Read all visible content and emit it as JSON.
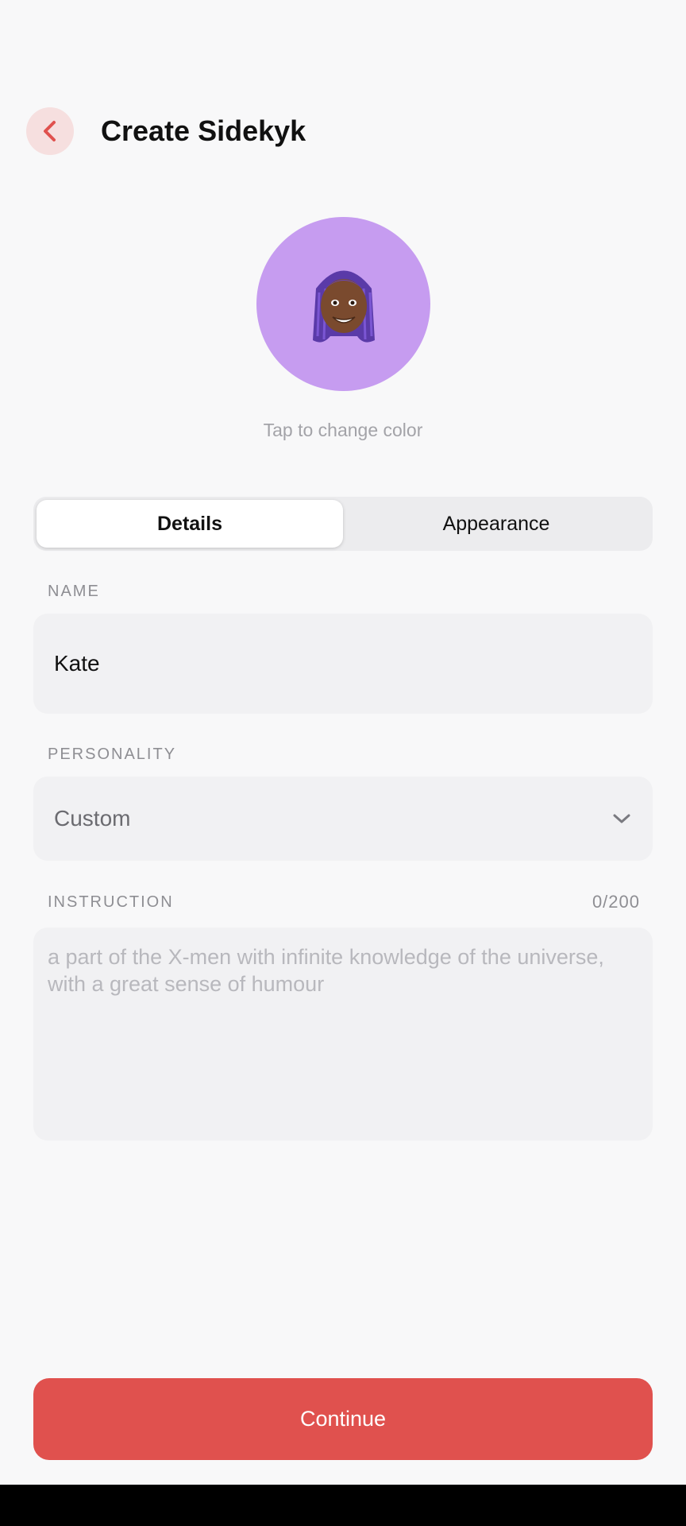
{
  "header": {
    "title": "Create Sidekyk",
    "back_icon": "chevron-left-icon",
    "back_color": "#e0514e"
  },
  "avatar": {
    "color": "#c69cf0",
    "icon": "memoji-avatar",
    "hint": "Tap to change color"
  },
  "tabs": [
    {
      "label": "Details",
      "active": true
    },
    {
      "label": "Appearance",
      "active": false
    }
  ],
  "form": {
    "name_label": "NAME",
    "name_value": "Kate",
    "personality_label": "PERSONALITY",
    "personality_value": "Custom",
    "instruction_label": "INSTRUCTION",
    "instruction_counter": "0/200",
    "instruction_placeholder": "a part of the X-men with infinite knowledge of the universe, with a great sense of humour"
  },
  "footer": {
    "continue_label": "Continue",
    "accent": "#e0514e"
  }
}
